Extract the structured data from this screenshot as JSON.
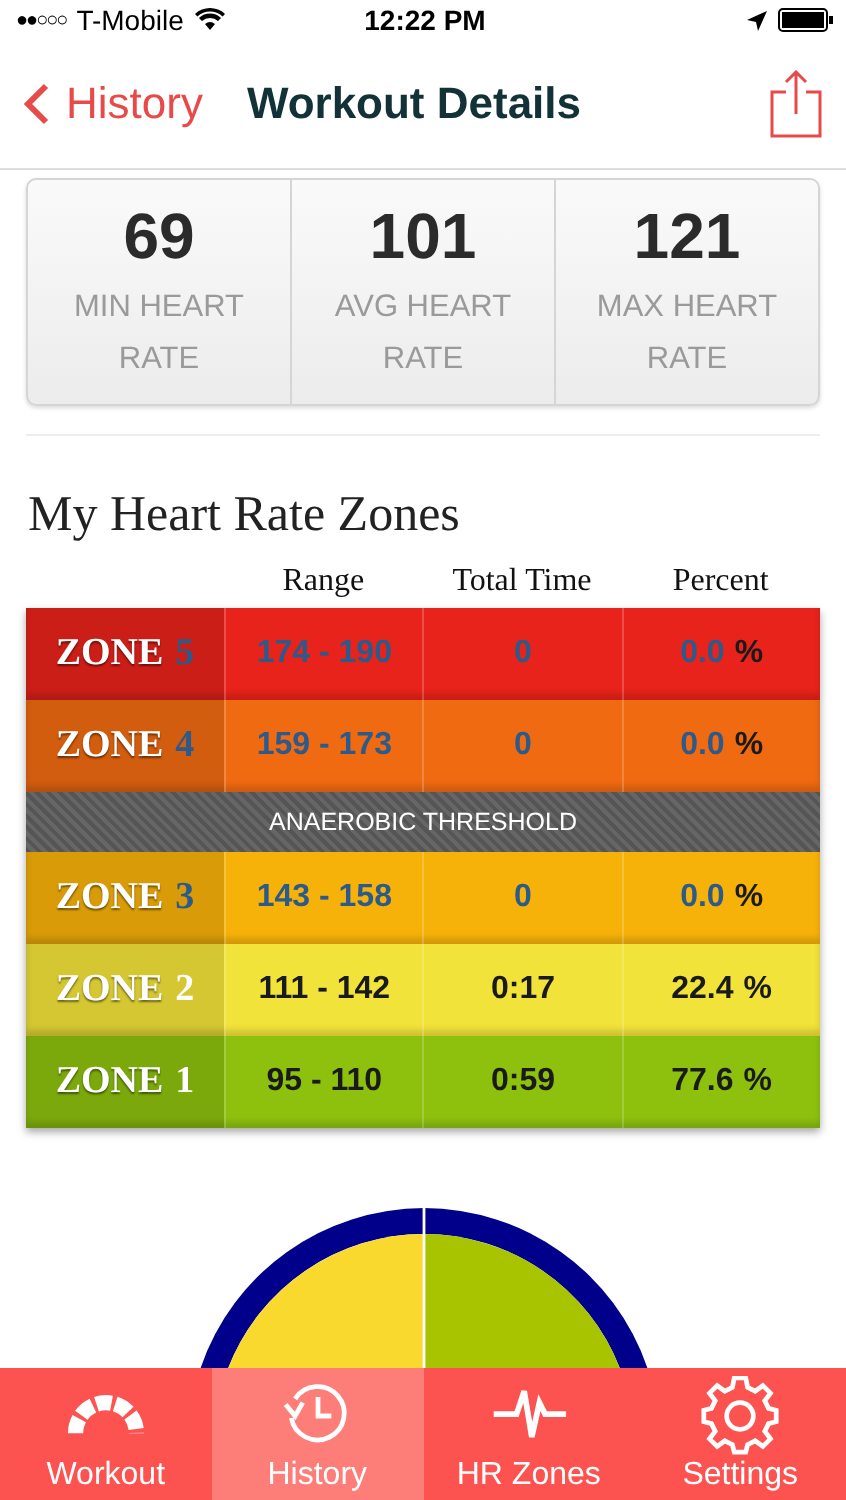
{
  "status_bar": {
    "signal": "●●○○○",
    "carrier": "T-Mobile",
    "time": "12:22 PM"
  },
  "nav": {
    "back": "History",
    "title": "Workout Details"
  },
  "stats": [
    {
      "value": "69",
      "label": "MIN HEART RATE"
    },
    {
      "value": "101",
      "label": "AVG HEART RATE"
    },
    {
      "value": "121",
      "label": "MAX HEART RATE"
    }
  ],
  "section_title": "My Heart Rate Zones",
  "columns": [
    "Range",
    "Total Time",
    "Percent"
  ],
  "zones": [
    {
      "kind": "zone",
      "label": "ZONE",
      "number": "5",
      "range": "174 - 190",
      "time": "0",
      "percent": "0.0",
      "unit": "%",
      "active": false,
      "color": "#e8231b"
    },
    {
      "kind": "zone",
      "label": "ZONE",
      "number": "4",
      "range": "159 - 173",
      "time": "0",
      "percent": "0.0",
      "unit": "%",
      "active": false,
      "color": "#f06a12"
    },
    {
      "kind": "divider",
      "label": "ANAEROBIC THRESHOLD"
    },
    {
      "kind": "zone",
      "label": "ZONE",
      "number": "3",
      "range": "143 - 158",
      "time": "0",
      "percent": "0.0",
      "unit": "%",
      "active": false,
      "color": "#f7b20a"
    },
    {
      "kind": "zone",
      "label": "ZONE",
      "number": "2",
      "range": "111 - 142",
      "time": "0:17",
      "percent": "22.4",
      "unit": "%",
      "active": true,
      "color": "#f2e33a"
    },
    {
      "kind": "zone",
      "label": "ZONE",
      "number": "1",
      "range": "95 - 110",
      "time": "0:59",
      "percent": "77.6",
      "unit": "%",
      "active": true,
      "color": "#8dc10e"
    }
  ],
  "tabs": [
    {
      "kind": "gauge",
      "label": "Workout",
      "selected": false
    },
    {
      "kind": "history",
      "label": "History",
      "selected": true
    },
    {
      "kind": "pulse",
      "label": "HR Zones",
      "selected": false
    },
    {
      "kind": "gear",
      "label": "Settings",
      "selected": false
    }
  ]
}
